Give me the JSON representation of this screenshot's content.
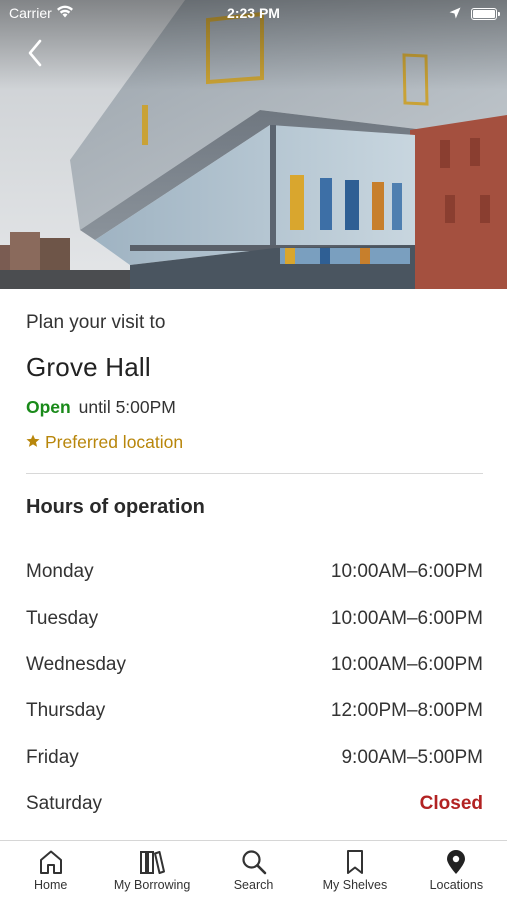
{
  "status_bar": {
    "carrier": "Carrier",
    "time": "2:23 PM"
  },
  "location": {
    "plan_label": "Plan your visit to",
    "name": "Grove Hall",
    "open_status": "Open",
    "open_until": "until 5:00PM",
    "preferred_label": "Preferred location"
  },
  "hours": {
    "heading": "Hours of operation",
    "rows": [
      {
        "day": "Monday",
        "time": "10:00AM–6:00PM"
      },
      {
        "day": "Tuesday",
        "time": "10:00AM–6:00PM"
      },
      {
        "day": "Wednesday",
        "time": "10:00AM–6:00PM"
      },
      {
        "day": "Thursday",
        "time": "12:00PM–8:00PM"
      },
      {
        "day": "Friday",
        "time": "9:00AM–5:00PM"
      },
      {
        "day": "Saturday",
        "time": "Closed"
      }
    ]
  },
  "tab_bar": {
    "tabs": [
      {
        "label": "Home",
        "icon": "home-icon"
      },
      {
        "label": "My Borrowing",
        "icon": "books-icon"
      },
      {
        "label": "Search",
        "icon": "search-icon"
      },
      {
        "label": "My Shelves",
        "icon": "bookmark-icon"
      },
      {
        "label": "Locations",
        "icon": "location-pin-icon"
      }
    ]
  },
  "colors": {
    "open": "#1a8a1a",
    "preferred": "#b8860b",
    "closed": "#b22222"
  }
}
